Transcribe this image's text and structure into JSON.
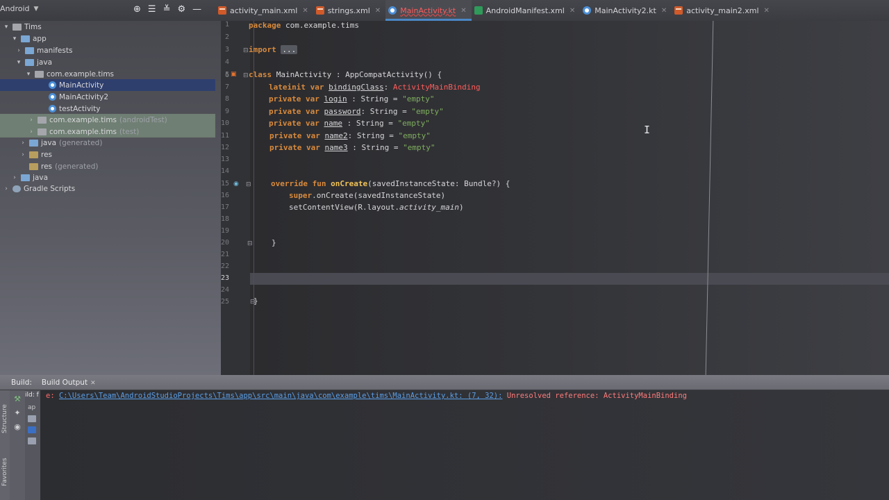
{
  "project_view": {
    "label": "Android"
  },
  "tabs": [
    {
      "label": "activity_main.xml",
      "icon": "xml-file-icon",
      "active": false
    },
    {
      "label": "strings.xml",
      "icon": "xml-file-icon",
      "active": false
    },
    {
      "label": "MainActivity.kt",
      "icon": "kotlin-file-icon",
      "active": true
    },
    {
      "label": "AndroidManifest.xml",
      "icon": "manifest-file-icon",
      "active": false
    },
    {
      "label": "MainActivity2.kt",
      "icon": "kotlin-file-icon",
      "active": false
    },
    {
      "label": "activity_main2.xml",
      "icon": "xml-file-icon",
      "active": false
    }
  ],
  "tree": {
    "root": "Tims",
    "app": "app",
    "manifests": "manifests",
    "java": "java",
    "package": "com.example.tims",
    "files": [
      "MainActivity",
      "MainActivity2",
      "testActivity"
    ],
    "android_test_pkg": "com.example.tims",
    "android_test_suffix": "(androidTest)",
    "test_pkg": "com.example.tims",
    "test_suffix": "(test)",
    "java_generated": "java",
    "java_generated_suffix": "(generated)",
    "res": "res",
    "res_generated": "res",
    "res_generated_suffix": "(generated)",
    "java2": "java",
    "gradle": "Gradle Scripts"
  },
  "editor": {
    "line_numbers": [
      "1",
      "2",
      "3",
      "4",
      "5",
      "6",
      "7",
      "8",
      "9",
      "10",
      "11",
      "12",
      "13",
      "14",
      "15",
      "16",
      "17",
      "18",
      "19",
      "20",
      "21",
      "22",
      "23",
      "24",
      "25"
    ],
    "current_line": "23",
    "code": {
      "l1_kw": "package",
      "l1_rest": " com.example.tims",
      "l3_kw": "import",
      "l3_fold": "...",
      "l6_kw": "class",
      "l6_rest": " MainActivity : AppCompatActivity() {",
      "l7_kw": "lateinit var",
      "l7_name": "bindingClass",
      "l7_colon": ": ",
      "l7_type": "ActivityMainBinding",
      "l8_kw": "private var",
      "l8_name": "login",
      "l8_rest": " : String = ",
      "l8_str": "\"empty\"",
      "l9_kw": "private var",
      "l9_name": "password",
      "l9_rest": ": String = ",
      "l9_str": "\"empty\"",
      "l10_kw": "private var",
      "l10_name": "name",
      "l10_rest": " : String = ",
      "l10_str": "\"empty\"",
      "l11_kw": "private var",
      "l11_name": "name2",
      "l11_rest": ": String = ",
      "l11_str": "\"empty\"",
      "l12_kw": "private var",
      "l12_name": "name3",
      "l12_rest": " : String = ",
      "l12_str": "\"empty\"",
      "l15_kw": "override fun",
      "l15_fn": "onCreate",
      "l15_rest": "(savedInstanceState: Bundle?) {",
      "l16_kw": "super",
      "l16_rest": ".onCreate(savedInstanceState)",
      "l17_rest": "setContentView(R.layout.",
      "l17_it": "activity_main",
      "l17_end": ")",
      "l20": "}",
      "l25": "}"
    }
  },
  "build": {
    "label": "Build:",
    "tab": "Build Output",
    "left_snippet": "ild: f",
    "left_snippet2": "ap",
    "error_prefix": "e: ",
    "error_path": "C:\\Users\\Team\\AndroidStudioProjects\\Tims\\app\\src\\main\\java\\com\\example\\tims\\MainActivity.kt: (7, 32):",
    "error_message": " Unresolved reference: ActivityMainBinding"
  },
  "side_labels": {
    "structure": "Structure",
    "favorites": "Favorites"
  },
  "colors": {
    "keyword": "#d98a3c",
    "string": "#7fae5e",
    "error": "#ff5c5c",
    "link": "#5b9fe8",
    "selection": "#2e3f6e"
  }
}
